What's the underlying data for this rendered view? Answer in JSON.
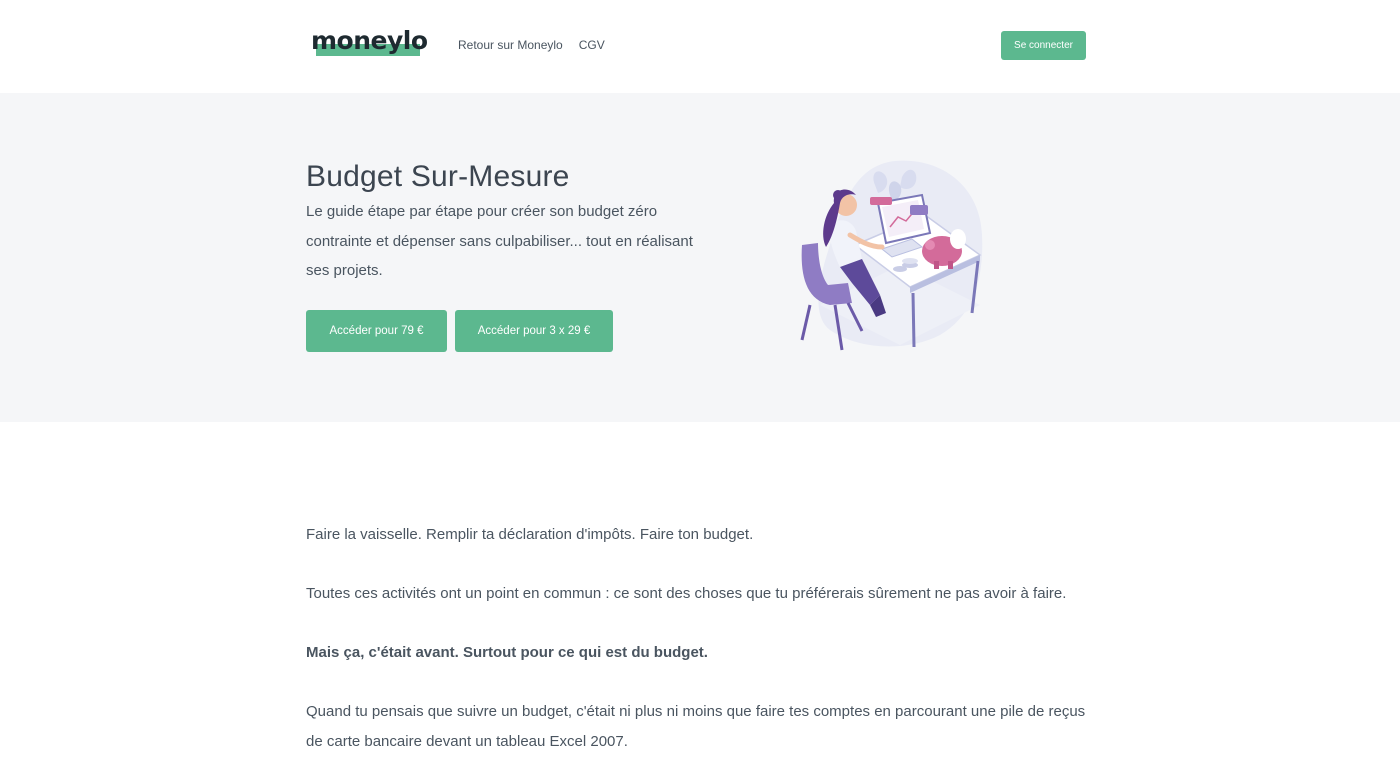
{
  "header": {
    "logo_text": "moneylo",
    "nav": [
      {
        "label": "Retour sur Moneylo"
      },
      {
        "label": "CGV"
      }
    ],
    "login_label": "Se connecter"
  },
  "hero": {
    "title": "Budget Sur-Mesure",
    "subtitle": "Le guide étape par étape pour créer son budget zéro contrainte et dépenser sans culpabiliser... tout en réalisant ses projets.",
    "buttons": [
      {
        "label": "Accéder pour 79 €"
      },
      {
        "label": "Accéder pour 3 x 29 €"
      }
    ],
    "illustration": "woman-at-desk-with-computer-and-piggy-bank"
  },
  "content": {
    "paragraphs": [
      {
        "text": "Faire la vaisselle. Remplir ta déclaration d'impôts. Faire ton budget."
      },
      {
        "text": "Toutes ces activités ont un point en commun : ce sont des choses que tu préférerais sûrement ne pas avoir à faire."
      },
      {
        "text": "Mais ça, c'était avant. Surtout pour ce qui est du budget."
      },
      {
        "text": "Quand tu pensais que suivre un budget, c'était ni plus ni moins que faire tes comptes en parcourant une pile de reçus de carte bancaire devant un tableau Excel 2007."
      }
    ]
  },
  "colors": {
    "accent": "#5cb88f",
    "hero_bg": "#f5f6f8",
    "text": "#4a5560",
    "logo_text": "#1e2a30"
  }
}
